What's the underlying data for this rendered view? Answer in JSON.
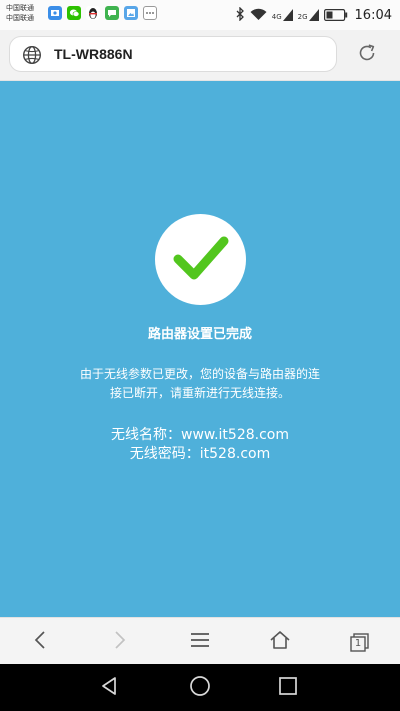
{
  "status_bar": {
    "carrier_lines": [
      "中国联通",
      "中国联通"
    ],
    "notification_icons": [
      {
        "name": "photo-app-icon",
        "color": "#3b8ee8"
      },
      {
        "name": "wechat-icon",
        "color": "#2dc100"
      },
      {
        "name": "qq-penguin-icon",
        "color": "#222222"
      },
      {
        "name": "messaging-app-icon",
        "color": "#3fb34f"
      },
      {
        "name": "gallery-app-icon",
        "color": "#58a6e8"
      },
      {
        "name": "more-notifications-icon",
        "color": "#8a8a8a"
      }
    ],
    "network_4g": "4G",
    "network_2g": "2G",
    "time": "16:04"
  },
  "browser": {
    "address_text": "TL-WR886N"
  },
  "page": {
    "background_color": "#4fb0da",
    "check_color": "#52c61e",
    "title": "路由器设置已完成",
    "message_lines": [
      "由于无线参数已更改，您的设备与路由器的连",
      "接已断开，请重新进行无线连接。"
    ],
    "wifi_name_label": "无线名称：",
    "wifi_name_value": "www.it528.com",
    "wifi_password_label": "无线密码：",
    "wifi_password_value": "it528.com"
  },
  "toolbar": {
    "buttons": [
      "back-icon",
      "forward-icon",
      "menu-icon",
      "home-icon",
      "tabs-icon"
    ],
    "tab_count": "1"
  }
}
